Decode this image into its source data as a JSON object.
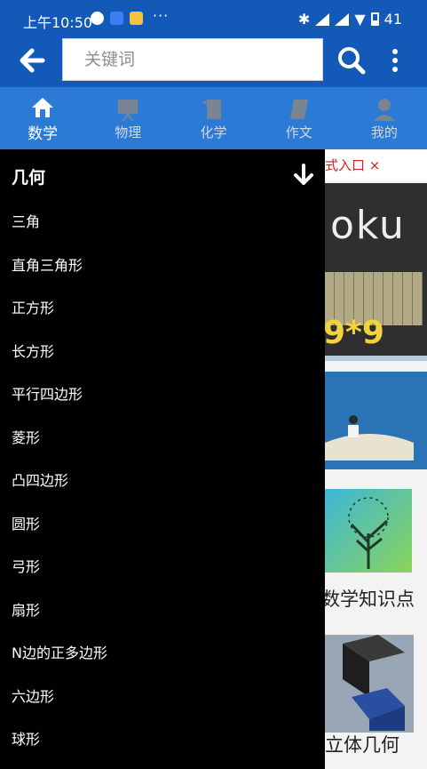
{
  "status_bar": {
    "time": "上午10:50",
    "signal_level": "41"
  },
  "header": {
    "search_placeholder": "关键词"
  },
  "tabs": [
    {
      "label": "数学",
      "icon": "house-icon"
    },
    {
      "label": "物理",
      "icon": "projector-icon"
    },
    {
      "label": "化学",
      "icon": "flask-icon"
    },
    {
      "label": "作文",
      "icon": "scroll-icon"
    },
    {
      "label": "我的",
      "icon": "person-icon"
    }
  ],
  "drawer": {
    "title": "几何",
    "items": [
      "三角",
      "直角三角形",
      "正方形",
      "长方形",
      "平行四边形",
      "菱形",
      "凸四边形",
      "圆形",
      "弓形",
      "扇形",
      "N边的正多边形",
      "六边形",
      "球形"
    ]
  },
  "background": {
    "notice_text": "式入口 ×",
    "card1_title": "oku",
    "card1_sub": "9*9",
    "card3_label": "数学知识点",
    "card4_label": "立体几何"
  }
}
